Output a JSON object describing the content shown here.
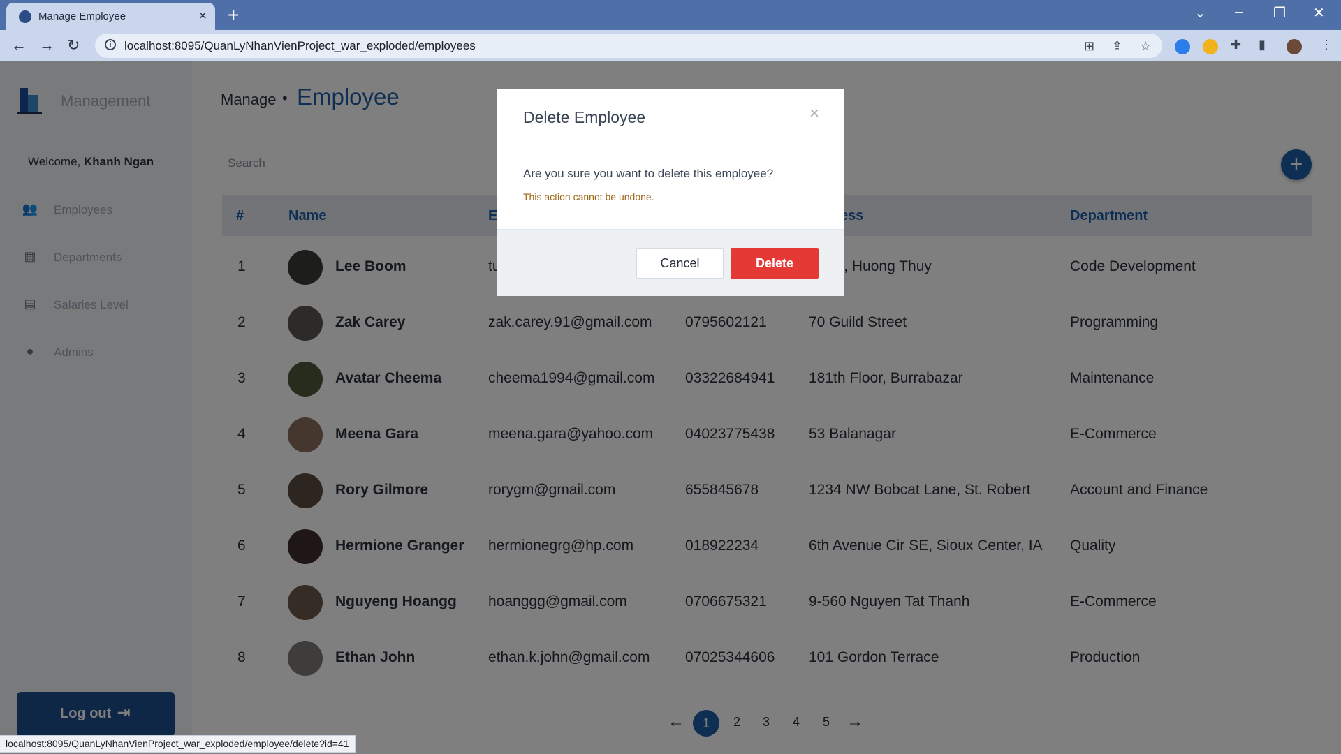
{
  "browser": {
    "tab_title": "Manage Employee",
    "url": "localhost:8095/QuanLyNhanVienProject_war_exploded/employees",
    "status_url": "localhost:8095/QuanLyNhanVienProject_war_exploded/employee/delete?id=41"
  },
  "sidebar": {
    "brand": "Management",
    "welcome_prefix": "Welcome,",
    "welcome_user": "Khanh Ngan",
    "items": [
      {
        "label": "Employees",
        "icon": "users-icon"
      },
      {
        "label": "Departments",
        "icon": "building-users-icon"
      },
      {
        "label": "Salaries Level",
        "icon": "invoice-dollar-icon"
      },
      {
        "label": "Admins",
        "icon": "user-icon"
      }
    ],
    "logout_label": "Log out"
  },
  "header": {
    "crumb": "Manage",
    "separator": "•",
    "page_title": "Employee"
  },
  "search": {
    "placeholder": "Search"
  },
  "table": {
    "columns": [
      "#",
      "Name",
      "E",
      "",
      "ess",
      "Department"
    ],
    "rows": [
      {
        "num": "1",
        "name": "Lee Boom",
        "email": "tu",
        "phone": "",
        "address": "Chau, Huong Thuy",
        "department": "Code Development",
        "avatar_color": "#3b3a38"
      },
      {
        "num": "2",
        "name": "Zak Carey",
        "email": "zak.carey.91@gmail.com",
        "phone": "0795602121",
        "address": "70 Guild Street",
        "department": "Programming",
        "avatar_color": "#5b5550"
      },
      {
        "num": "3",
        "name": "Avatar Cheema",
        "email": "cheema1994@gmail.com",
        "phone": "03322684941",
        "address": "181th Floor, Burrabazar",
        "department": "Maintenance",
        "avatar_color": "#4d5a3a"
      },
      {
        "num": "4",
        "name": "Meena Gara",
        "email": "meena.gara@yahoo.com",
        "phone": "04023775438",
        "address": "53 Balanagar",
        "department": "E-Commerce",
        "avatar_color": "#8a6d5c"
      },
      {
        "num": "5",
        "name": "Rory Gilmore",
        "email": "rorygm@gmail.com",
        "phone": "655845678",
        "address": "1234 NW Bobcat Lane, St. Robert",
        "department": "Account and Finance",
        "avatar_color": "#5a4a40"
      },
      {
        "num": "6",
        "name": "Hermione Granger",
        "email": "hermionegrg@hp.com",
        "phone": "018922234",
        "address": "6th Avenue Cir SE, Sioux Center, IA",
        "department": "Quality",
        "avatar_color": "#3d2e2b"
      },
      {
        "num": "7",
        "name": "Nguyeng Hoangg",
        "email": "hoanggg@gmail.com",
        "phone": "0706675321",
        "address": "9-560 Nguyen Tat Thanh",
        "department": "E-Commerce",
        "avatar_color": "#6b5b4a"
      },
      {
        "num": "8",
        "name": "Ethan John",
        "email": "ethan.k.john@gmail.com",
        "phone": "07025344606",
        "address": "101 Gordon Terrace",
        "department": "Production",
        "avatar_color": "#7d7a76"
      }
    ]
  },
  "pagination": {
    "prev": "←",
    "pages": [
      "1",
      "2",
      "3",
      "4",
      "5"
    ],
    "active": "1",
    "next": "→"
  },
  "modal": {
    "title": "Delete Employee",
    "close": "×",
    "question": "Are you sure you want to delete this employee?",
    "warning": "This action cannot be undone.",
    "cancel_label": "Cancel",
    "delete_label": "Delete"
  },
  "colors": {
    "accent": "#1c5fa6",
    "danger": "#e53935",
    "warning_text": "#a0691b"
  }
}
